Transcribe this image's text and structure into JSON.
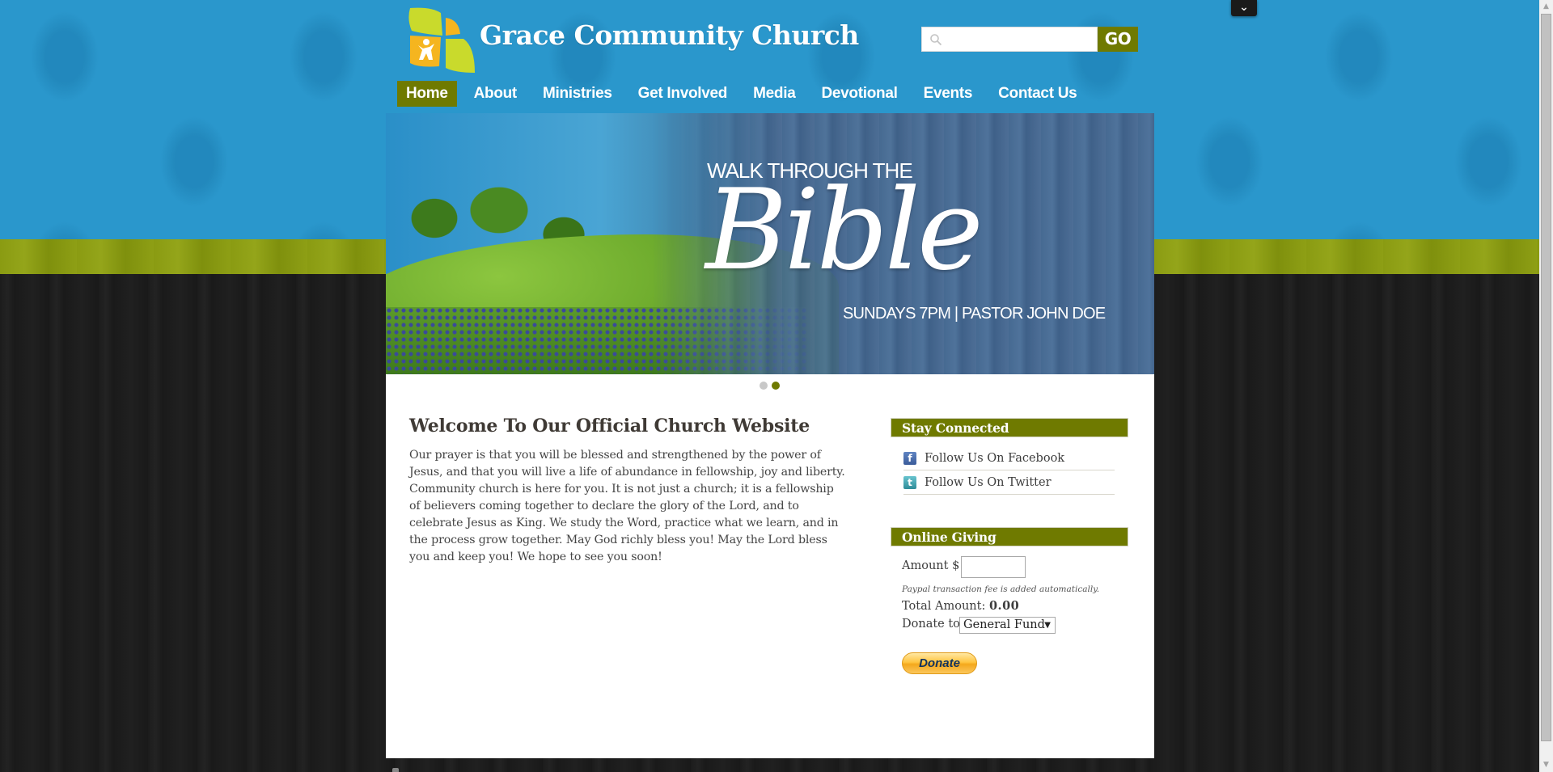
{
  "colors": {
    "brand_green": "#6f7a00",
    "header_blue": "#2a97cc",
    "band_green": "#8a9b12",
    "wood_dark": "#1b1b1b",
    "donate_gold": "#ffc541"
  },
  "header": {
    "site_title": "Grace Community Church",
    "logo_icon": "church-logo-icon",
    "panel_toggle_glyph": "⌄"
  },
  "search": {
    "placeholder": "",
    "value": "",
    "icon": "search-icon",
    "go_label": "GO"
  },
  "nav": {
    "items": [
      {
        "label": "Home",
        "active": true
      },
      {
        "label": "About",
        "active": false
      },
      {
        "label": "Ministries",
        "active": false
      },
      {
        "label": "Get Involved",
        "active": false
      },
      {
        "label": "Media",
        "active": false
      },
      {
        "label": "Devotional",
        "active": false
      },
      {
        "label": "Events",
        "active": false
      },
      {
        "label": "Contact Us",
        "active": false
      }
    ]
  },
  "slider": {
    "kicker": "WALK THROUGH THE",
    "title": "Bible",
    "subtitle": "SUNDAYS 7PM | PASTOR JOHN DOE",
    "slide_count": 2,
    "active_slide": 2
  },
  "main": {
    "title": "Welcome To Our Official Church Website",
    "body": "Our prayer is that you will be blessed and strengthened by the power of Jesus, and that you will live a life of abundance in fellowship, joy and liberty. Community church is here for you. It is not just a church; it is a fellowship of believers coming together to declare the glory of the Lord, and to celebrate Jesus as King. We study the Word, practice what we learn, and in the process grow together. May God richly bless you! May the Lord bless you and keep you! We hope to see you soon!"
  },
  "sidebar": {
    "stay_connected": {
      "title": "Stay Connected",
      "links": [
        {
          "label": "Follow Us On Facebook",
          "icon": "facebook-icon",
          "glyph": "f"
        },
        {
          "label": "Follow Us On Twitter",
          "icon": "twitter-icon",
          "glyph": "t"
        }
      ]
    },
    "online_giving": {
      "title": "Online Giving",
      "amount_label": "Amount $",
      "amount_value": "",
      "fee_note": "Paypal transaction fee is added automatically.",
      "total_label": "Total Amount:",
      "total_value": "0.00",
      "donate_to_label": "Donate to",
      "donate_to_selected": "General Fund",
      "donate_button": "Donate"
    }
  },
  "scrollbar": {
    "up_glyph": "▲",
    "down_glyph": "▼"
  }
}
